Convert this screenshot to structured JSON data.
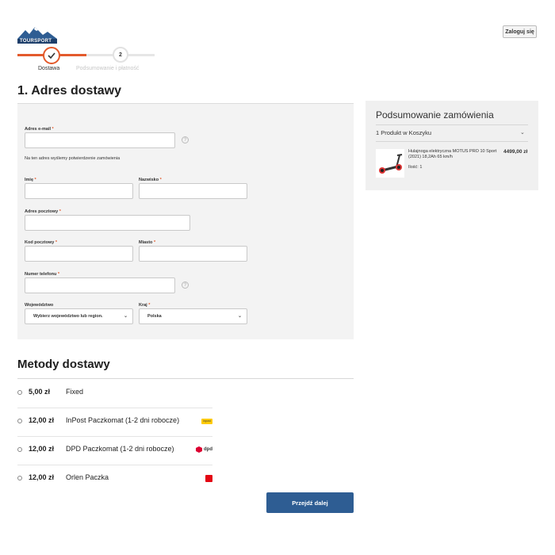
{
  "header": {
    "logo_text": "TOURSPORT",
    "login_label": "Zaloguj się"
  },
  "steps": [
    {
      "number": "1",
      "label": "Dostawa",
      "status": "completed"
    },
    {
      "number": "2",
      "label": "Podsumowanie i płatność",
      "status": "upcoming"
    }
  ],
  "page_title": "1. Adres dostawy",
  "form": {
    "email_label": "Adres e-mail",
    "email_hint": "Na ten adres wyślemy potwierdzenie zamówienia",
    "first_name_label": "Imię",
    "last_name_label": "Nazwisko",
    "street_label": "Adres pocztowy",
    "postcode_label": "Kod pocztowy",
    "city_label": "Miasto",
    "phone_label": "Numer telefonu",
    "region_label": "Województwo",
    "region_value": "Wybierz województwo lub region.",
    "country_label": "Kraj",
    "country_value": "Polska",
    "required_mark": "*",
    "help_mark": "?"
  },
  "shipping": {
    "title": "Metody dostawy",
    "methods": [
      {
        "price": "5,00 zł",
        "name": "Fixed",
        "logo": ""
      },
      {
        "price": "12,00 zł",
        "name": "InPost Paczkomat (1-2 dni robocze)",
        "logo": "inpost"
      },
      {
        "price": "12,00 zł",
        "name": "DPD Paczkomat (1-2 dni robocze)",
        "logo": "dpd"
      },
      {
        "price": "12,00 zł",
        "name": "Orlen Paczka",
        "logo": "orlen"
      }
    ],
    "logo_dpd_text": "dpd",
    "logo_inpost_text": "inpost"
  },
  "next_button": "Przejdź dalej",
  "summary": {
    "title": "Podsumowanie zamówienia",
    "count": "1 Produkt w Koszyku",
    "product_name": "Hulajnoga elektryczna MOTUS PRO 10 Sport (2021) 18,2Ah 65 km/h",
    "product_qty": "Ilość: 1",
    "product_price": "4499,00 zł"
  },
  "colors": {
    "accent": "#e35a2c",
    "button": "#2e5d93",
    "panel": "#f3f3f3"
  }
}
